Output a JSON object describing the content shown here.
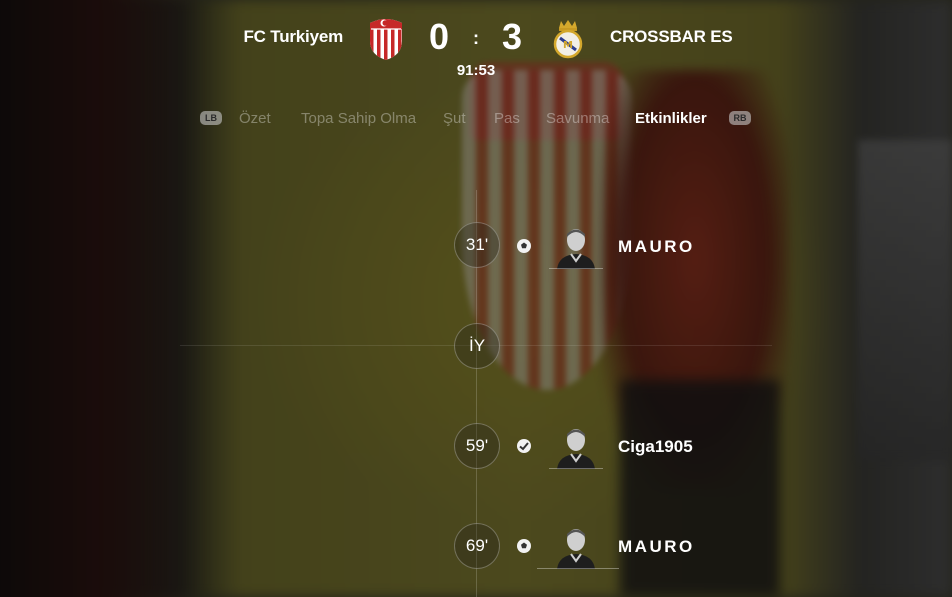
{
  "match": {
    "home_team": "FC Turkiyem",
    "away_team": "CROSSBAR ES",
    "home_score": "0",
    "separator": ":",
    "away_score": "3",
    "clock": "91:53",
    "home_crest_icon": "red-white-striped-shield-crest",
    "away_crest_icon": "white-gold-crown-crest"
  },
  "tabs": {
    "left_bumper": "LB",
    "right_bumper": "RB",
    "items": [
      {
        "label": "Özet"
      },
      {
        "label": "Topa Sahip Olma"
      },
      {
        "label": "Şut"
      },
      {
        "label": "Pas"
      },
      {
        "label": "Savunma"
      },
      {
        "label": "Etkinlikler"
      }
    ],
    "active_index": 5
  },
  "events": [
    {
      "minute": "31'",
      "icon": "goal-ball-icon",
      "player": "MAURO"
    },
    {
      "minute": "İY",
      "icon": "halftime-marker",
      "player": ""
    },
    {
      "minute": "59'",
      "icon": "assist-boot-icon",
      "player": "Ciga1905"
    },
    {
      "minute": "69'",
      "icon": "goal-ball-icon",
      "player": "MAURO"
    }
  ],
  "colors": {
    "accent_red": "#c0392b",
    "active_tab": "#ffffff",
    "inactive_tab": "rgba(255,255,255,0.35)"
  }
}
